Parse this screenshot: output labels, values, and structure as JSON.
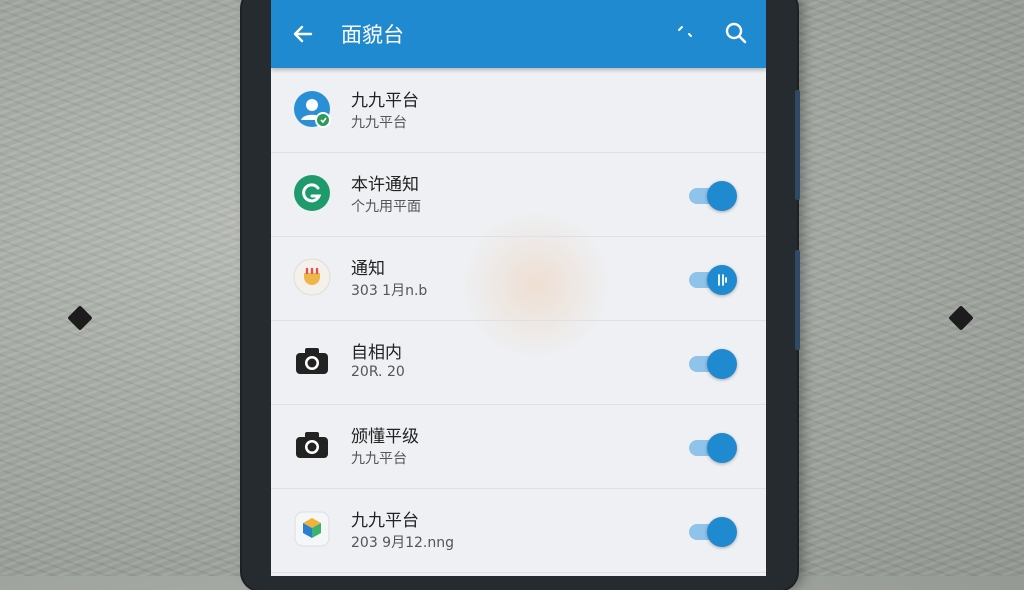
{
  "appbar": {
    "title": "面貌台",
    "icons": {
      "back": "arrow-back-icon",
      "more": "more-icon",
      "search": "search-icon"
    }
  },
  "rows": [
    {
      "label": "九九平台",
      "sub": "九九平台",
      "icon": "account-icon",
      "toggle": null
    },
    {
      "label": "本许通知",
      "sub": "个九用平面",
      "icon": "g-logo-icon",
      "toggle": true
    },
    {
      "label": "通知",
      "sub": "303 1月n.b",
      "icon": "app-icon",
      "toggle": true
    },
    {
      "label": "自相内",
      "sub": "20R. 20",
      "icon": "camera-icon",
      "toggle": true
    },
    {
      "label": "颁懂平级",
      "sub": "九九平台",
      "icon": "camera-icon",
      "toggle": true
    },
    {
      "label": "九九平台",
      "sub": "203 9月12.nng",
      "icon": "cube-app-icon",
      "toggle": true
    }
  ],
  "colors": {
    "accent": "#1f8ad0",
    "track": "#8fc3ea",
    "screen_bg": "#eef0f3"
  }
}
